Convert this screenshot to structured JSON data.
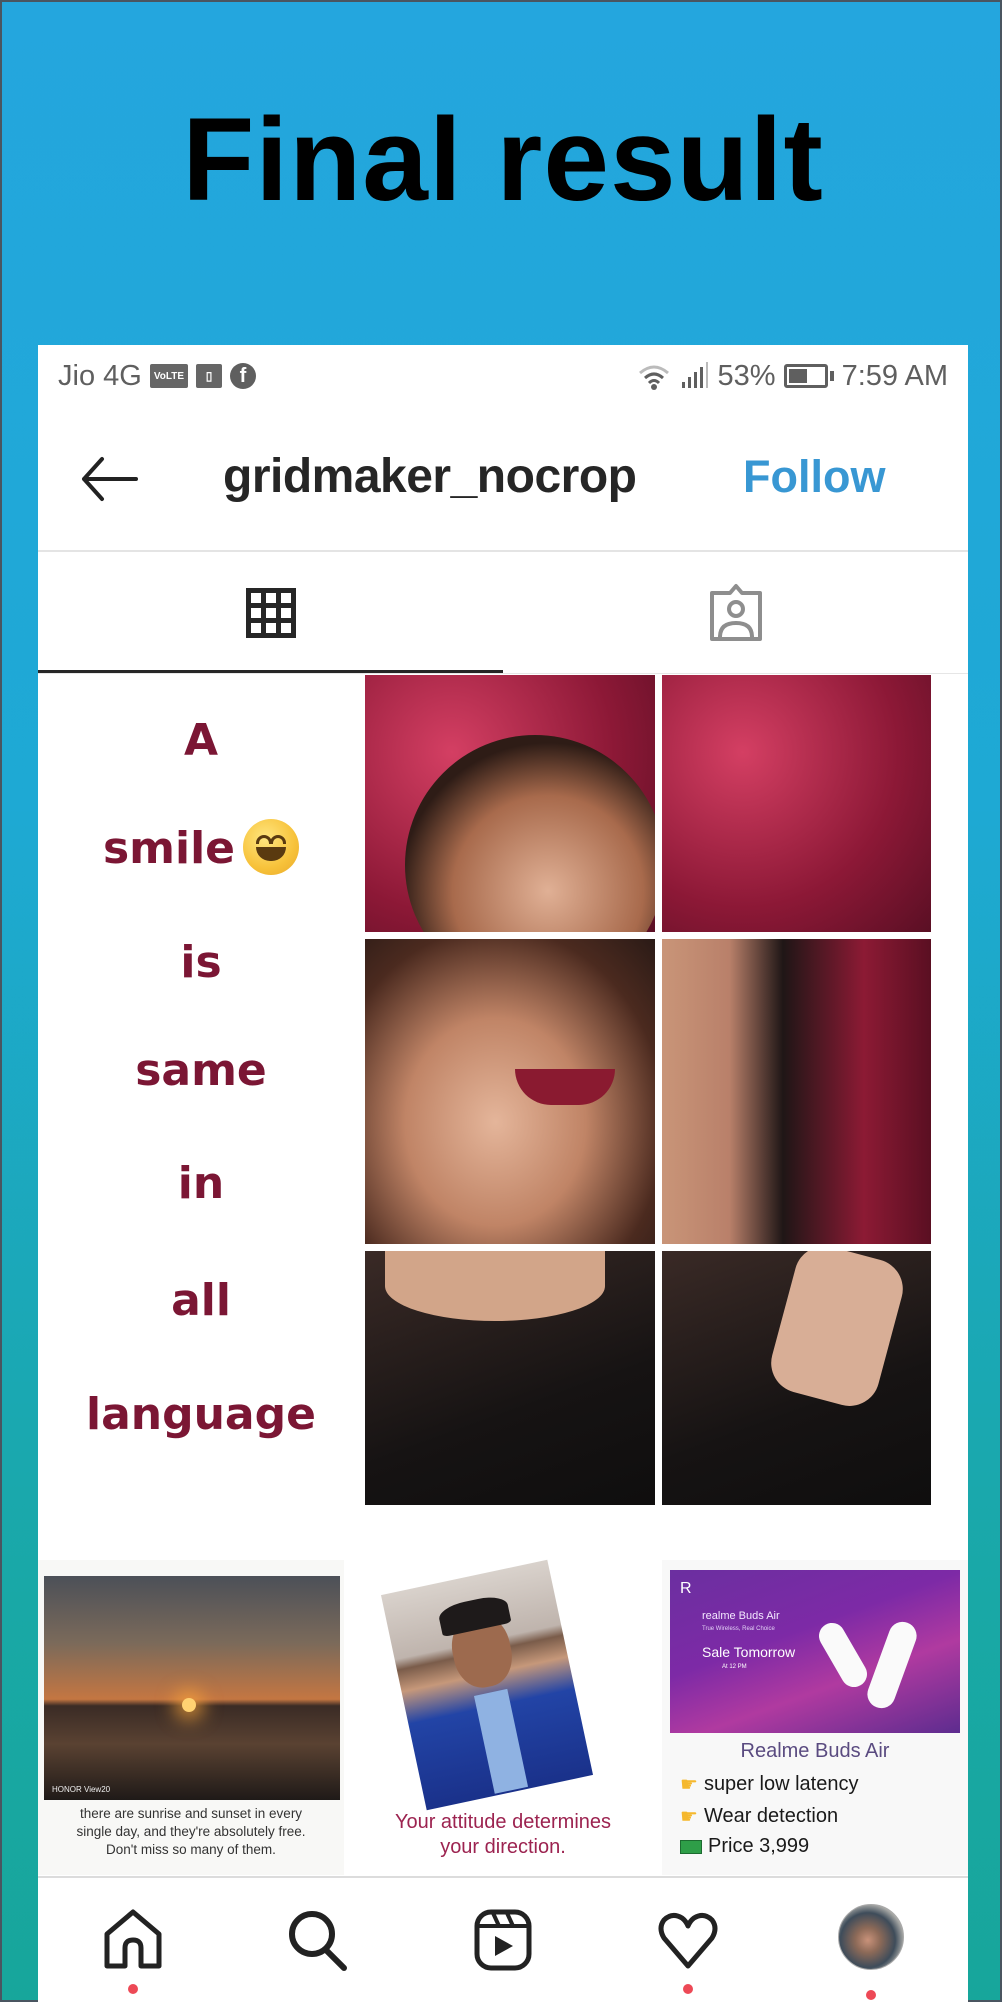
{
  "banner": {
    "title": "Final result"
  },
  "status_bar": {
    "carrier": "Jio 4G",
    "volte_badge": "VoLTE",
    "icons_left": [
      "volte-icon",
      "sim-icon",
      "facebook-icon"
    ],
    "icons_right": [
      "wifi-icon",
      "signal-icon",
      "battery-icon"
    ],
    "battery_percent": "53%",
    "battery_level": 0.53,
    "time": "7:59 AM"
  },
  "top_nav": {
    "back_icon": "arrow-left-icon",
    "username": "gridmaker_nocrop",
    "follow_label": "Follow"
  },
  "tabs": [
    {
      "name": "posts-grid",
      "icon": "grid-icon",
      "active": true
    },
    {
      "name": "tagged",
      "icon": "tagged-person-icon",
      "active": false
    }
  ],
  "grid_post": {
    "quote_words": [
      "A",
      "smile",
      "is",
      "same",
      "in",
      "all",
      "language"
    ],
    "emoji": "smiling-face-icon",
    "photo_tiles": 6
  },
  "posts": {
    "sunset": {
      "watermark": "HONOR View20",
      "caption_lines": [
        "there are sunrise and sunset in every",
        "single day, and they're absolutely free.",
        "Don't miss so many of them."
      ]
    },
    "attitude": {
      "caption_lines": [
        "Your attitude determines",
        "your direction."
      ]
    },
    "realme": {
      "logo": "R",
      "banner_brand": "realme Buds Air",
      "banner_tagline": "True Wireless, Real Choice",
      "banner_sale": "Sale Tomorrow",
      "banner_time": "At 12 PM",
      "title": "Realme Buds Air",
      "features": [
        "super low latency",
        "Wear detection"
      ],
      "price": "Price 3,999"
    }
  },
  "bottom_nav": {
    "items": [
      {
        "name": "home",
        "icon": "home-icon",
        "has_dot": true
      },
      {
        "name": "search",
        "icon": "search-icon",
        "has_dot": false
      },
      {
        "name": "reels",
        "icon": "reels-icon",
        "has_dot": false
      },
      {
        "name": "activity",
        "icon": "heart-icon",
        "has_dot": true
      },
      {
        "name": "profile",
        "icon": "avatar",
        "has_dot": true
      }
    ],
    "notification_color": "#ed4956"
  },
  "colors": {
    "follow_blue": "#3897d3",
    "quote_maroon": "#7b1634",
    "banner_blue": "#24a6de",
    "banner_teal": "#17a69b"
  }
}
